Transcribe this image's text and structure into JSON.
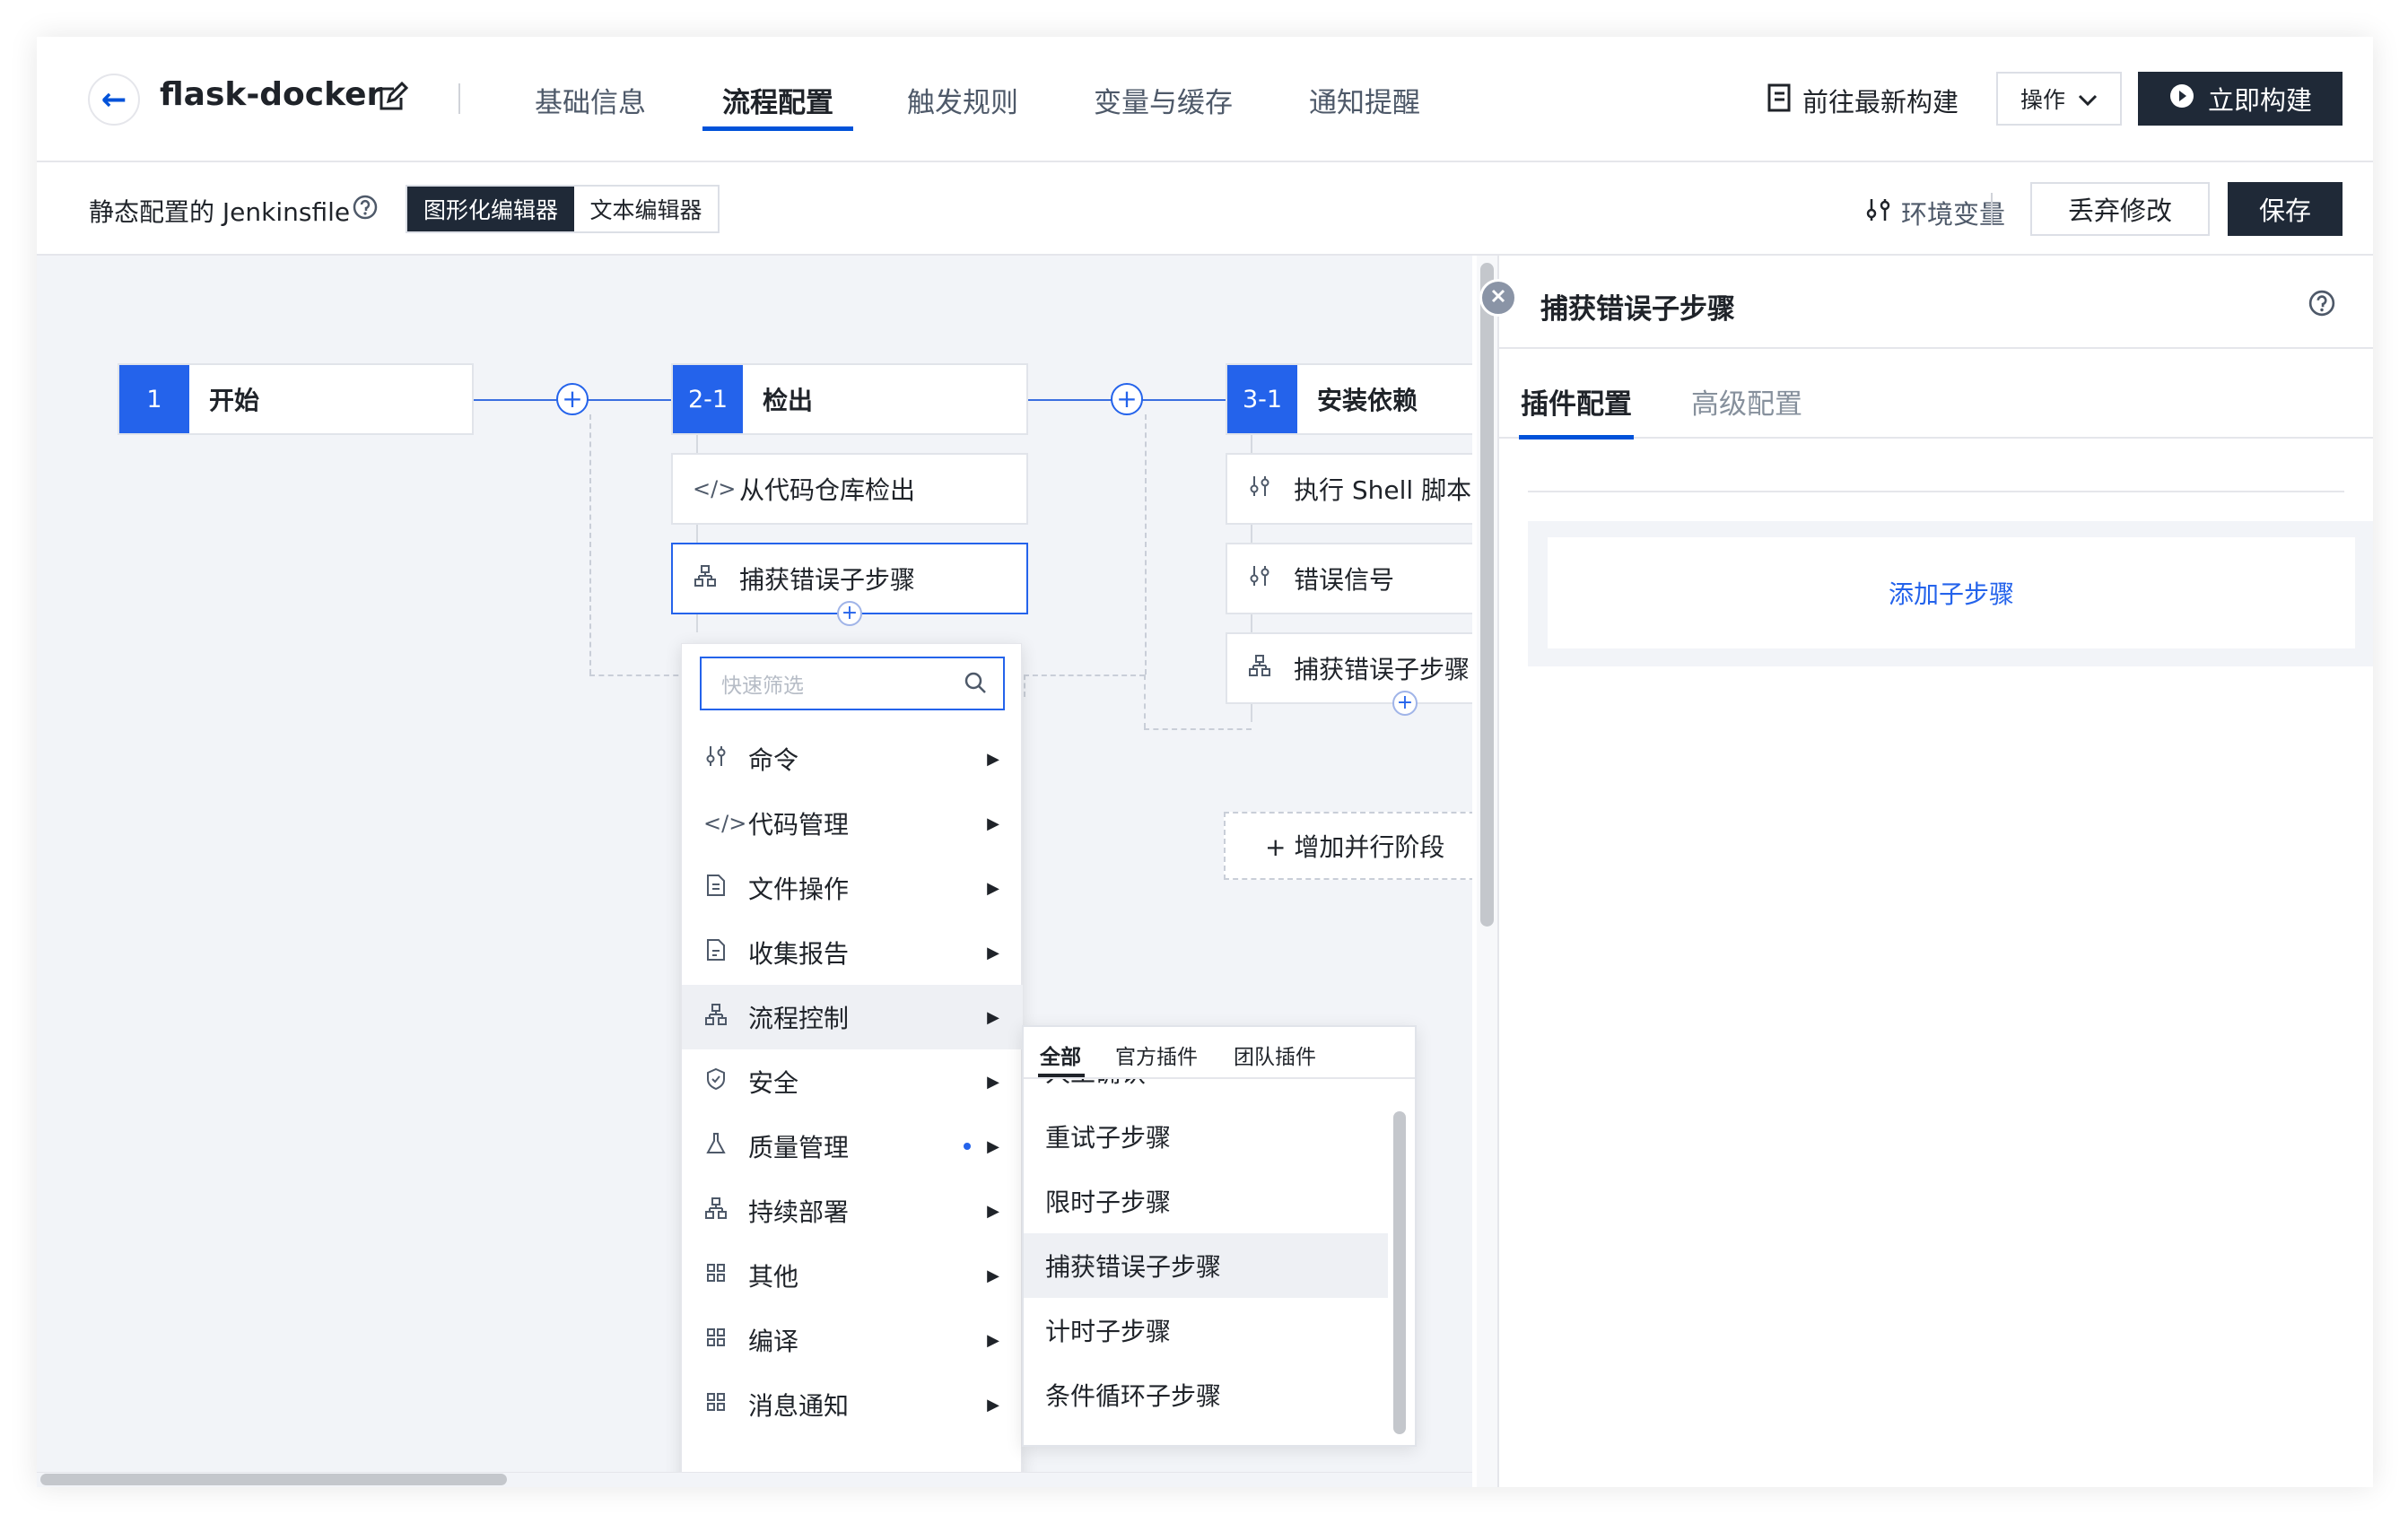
{
  "header": {
    "project_name": "flask-docker",
    "tabs": [
      {
        "label": "基础信息"
      },
      {
        "label": "流程配置"
      },
      {
        "label": "触发规则"
      },
      {
        "label": "变量与缓存"
      },
      {
        "label": "通知提醒"
      }
    ],
    "active_tab": "流程配置",
    "goto_latest": "前往最新构建",
    "ops_label": "操作",
    "build_now": "立即构建"
  },
  "toolbar": {
    "static_label": "静态配置的 Jenkinsfile",
    "mode_graphic": "图形化编辑器",
    "mode_text": "文本编辑器",
    "env_vars": "环境变量",
    "discard": "丢弃修改",
    "save": "保存"
  },
  "pipeline": {
    "stages": [
      {
        "num": "1",
        "name": "开始",
        "steps": []
      },
      {
        "num": "2-1",
        "name": "检出",
        "steps": [
          {
            "label": "从代码仓库检出",
            "icon": "code-icon"
          },
          {
            "label": "捕获错误子步骤",
            "icon": "flow-icon"
          }
        ]
      },
      {
        "num": "3-1",
        "name": "安装依赖",
        "steps": [
          {
            "label": "执行 Shell 脚本",
            "icon": "sliders-icon"
          },
          {
            "label": "错误信号",
            "icon": "sliders-icon"
          },
          {
            "label": "捕获错误子步骤",
            "icon": "flow-icon"
          }
        ]
      }
    ],
    "add_parallel": "+ 增加并行阶段"
  },
  "picker": {
    "search_placeholder": "快速筛选",
    "categories": [
      {
        "label": "命令",
        "icon": "sliders-icon"
      },
      {
        "label": "代码管理",
        "icon": "code-icon"
      },
      {
        "label": "文件操作",
        "icon": "file-icon"
      },
      {
        "label": "收集报告",
        "icon": "report-icon"
      },
      {
        "label": "流程控制",
        "icon": "flow-icon"
      },
      {
        "label": "安全",
        "icon": "shield-icon"
      },
      {
        "label": "质量管理",
        "icon": "flask-icon"
      },
      {
        "label": "持续部署",
        "icon": "flow-icon"
      },
      {
        "label": "其他",
        "icon": "grid-icon"
      },
      {
        "label": "编译",
        "icon": "grid-icon"
      },
      {
        "label": "消息通知",
        "icon": "grid-icon"
      }
    ],
    "active_category": "流程控制",
    "sub_tabs": [
      "全部",
      "官方插件",
      "团队插件"
    ],
    "sub_items": [
      "人工确认",
      "重试子步骤",
      "限时子步骤",
      "捕获错误子步骤",
      "计时子步骤",
      "条件循环子步骤"
    ],
    "active_sub_item": "捕获错误子步骤"
  },
  "panel": {
    "title": "捕获错误子步骤",
    "tabs": [
      "插件配置",
      "高级配置"
    ],
    "add_substep": "添加子步骤"
  },
  "colors": {
    "accent": "#2463eb",
    "dark": "#1f2937"
  }
}
